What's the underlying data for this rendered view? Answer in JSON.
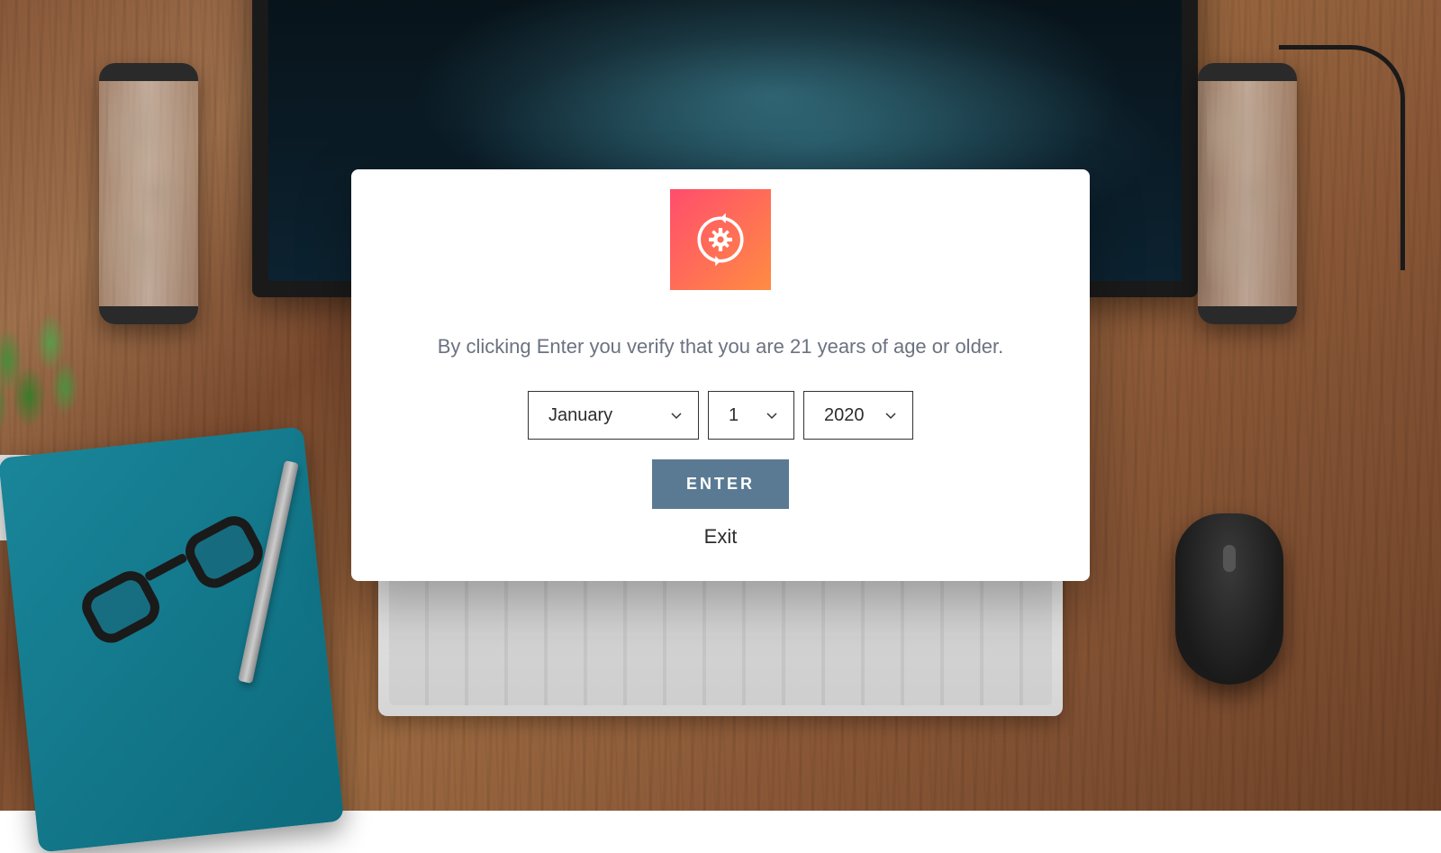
{
  "modal": {
    "logo_icon": "gear-cycle-icon",
    "verify_text": "By clicking Enter you verify that you are 21 years of age or older.",
    "date": {
      "month": "January",
      "day": "1",
      "year": "2020"
    },
    "enter_label": "ENTER",
    "exit_label": "Exit"
  },
  "colors": {
    "logo_gradient_start": "#ff4d6d",
    "logo_gradient_end": "#ff8c42",
    "enter_button": "#5a7a94",
    "text_muted": "#6b7280"
  }
}
